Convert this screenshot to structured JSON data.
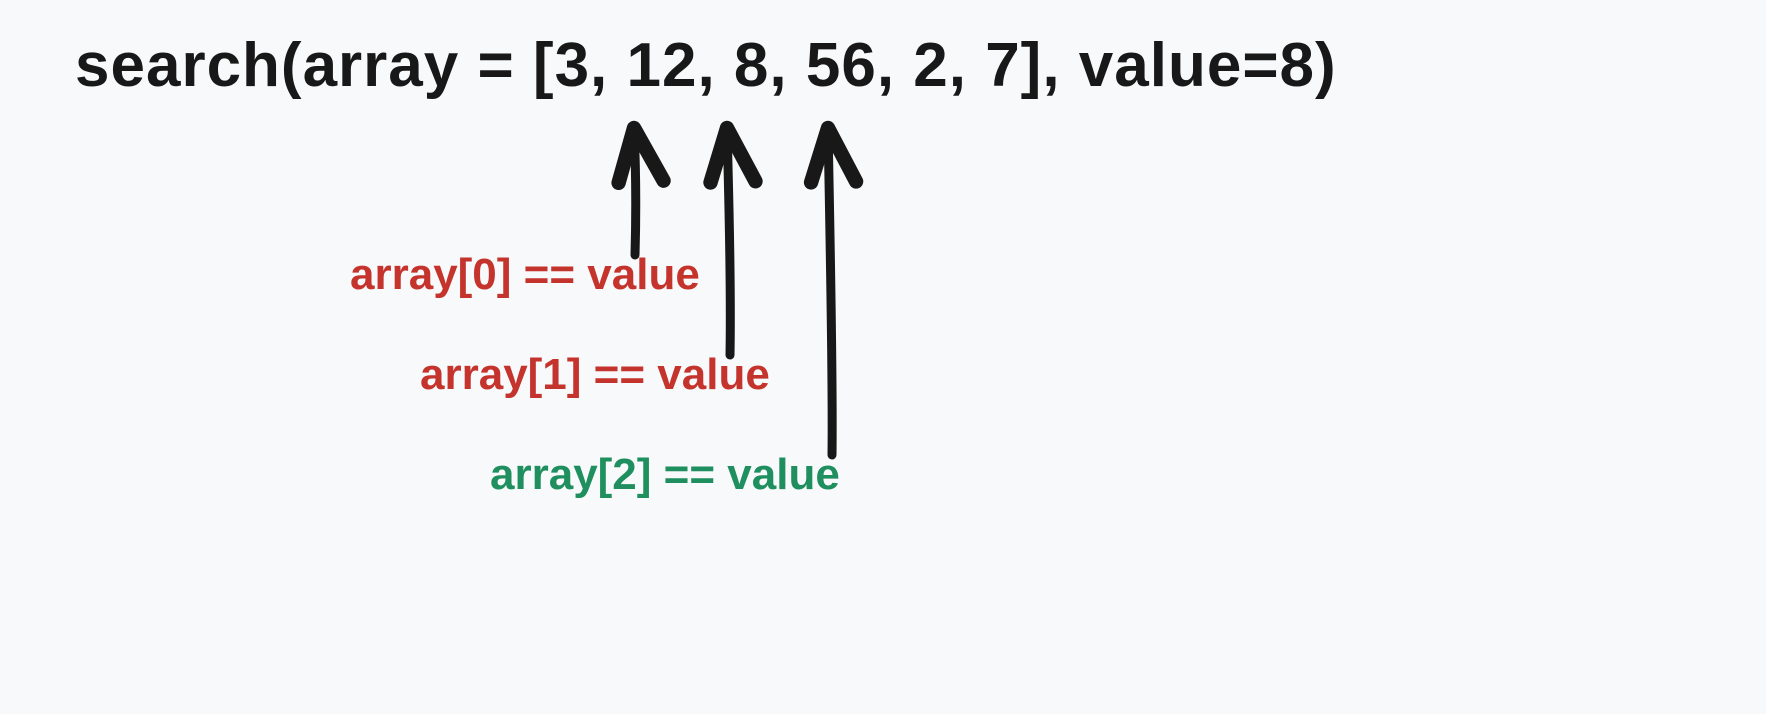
{
  "headline": "search(array = [3, 12, 8, 56, 2, 7], value=8)",
  "steps": {
    "s0": "array[0] == value",
    "s1": "array[1] == value",
    "s2": "array[2] == value"
  },
  "colors": {
    "fail": "#c5332d",
    "success": "#1f8f5f",
    "ink": "#181818",
    "bg": "#f7f9fa"
  },
  "chart_data": {
    "type": "table",
    "title": "Linear search trace",
    "function": "search",
    "array": [
      3,
      12,
      8,
      56,
      2,
      7
    ],
    "target_value": 8,
    "comparisons": [
      {
        "index": 0,
        "expr": "array[0] == value",
        "element": 3,
        "match": false
      },
      {
        "index": 1,
        "expr": "array[1] == value",
        "element": 12,
        "match": false
      },
      {
        "index": 2,
        "expr": "array[2] == value",
        "element": 8,
        "match": true
      }
    ],
    "result_index": 2
  }
}
